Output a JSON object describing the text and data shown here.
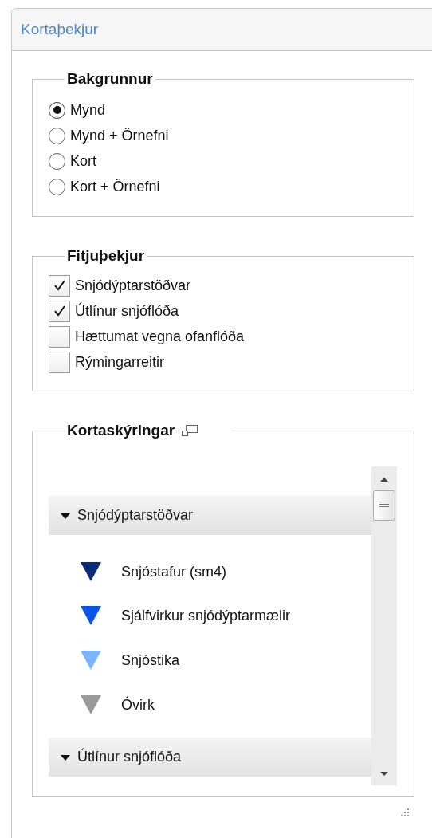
{
  "panel": {
    "title": "Kortaþekjur"
  },
  "background": {
    "legend": "Bakgrunnur",
    "options": [
      {
        "label": "Mynd",
        "selected": true
      },
      {
        "label": "Mynd + Örnefni",
        "selected": false
      },
      {
        "label": "Kort",
        "selected": false
      },
      {
        "label": "Kort + Örnefni",
        "selected": false
      }
    ]
  },
  "features": {
    "legend": "Fitjuþekjur",
    "layers": [
      {
        "label": "Snjódýptarstöðvar",
        "checked": true
      },
      {
        "label": "Útlínur snjóflóða",
        "checked": true
      },
      {
        "label": "Hættumat vegna ofanflóða",
        "checked": false
      },
      {
        "label": "Rýmingarreitir",
        "checked": false
      }
    ]
  },
  "map_legend": {
    "legend": "Kortaskýringar",
    "groups": [
      {
        "title": "Snjódýptarstöðvar",
        "expanded": true,
        "items": [
          {
            "label": "Snjóstafur (sm4)",
            "color": "#0a2a7a"
          },
          {
            "label": "Sjálfvirkur snjódýptarmælir",
            "color": "#0a55e6"
          },
          {
            "label": "Snjóstika",
            "color": "#7ab6ff"
          },
          {
            "label": "Óvirk",
            "color": "#9a9a9a"
          }
        ]
      },
      {
        "title": "Útlínur snjóflóða",
        "expanded": true
      }
    ]
  }
}
